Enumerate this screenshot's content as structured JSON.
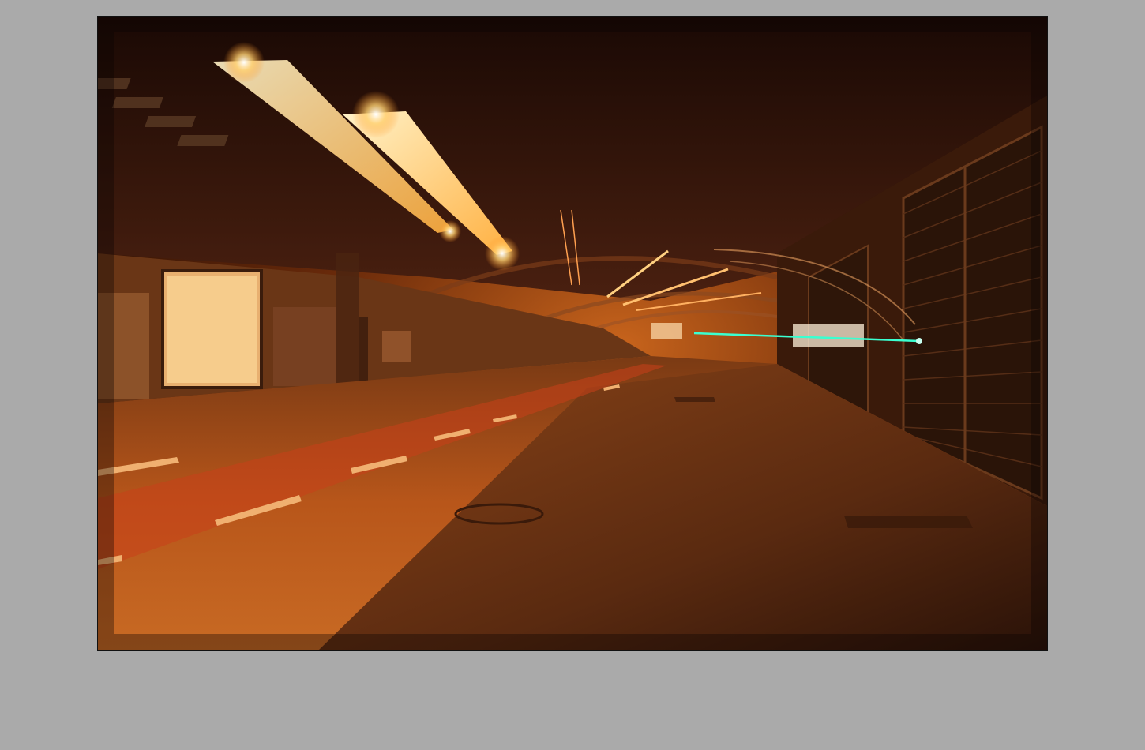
{
  "viewer": {
    "background_color": "#aaaaaa",
    "frame_border_color": "#111111"
  },
  "photo": {
    "subject": "night-underpass-tunnel",
    "palette": {
      "ceiling": "#2a1206",
      "road": "#8a3a0e",
      "light": "#ffd38a",
      "laser": "#3affd0"
    }
  }
}
